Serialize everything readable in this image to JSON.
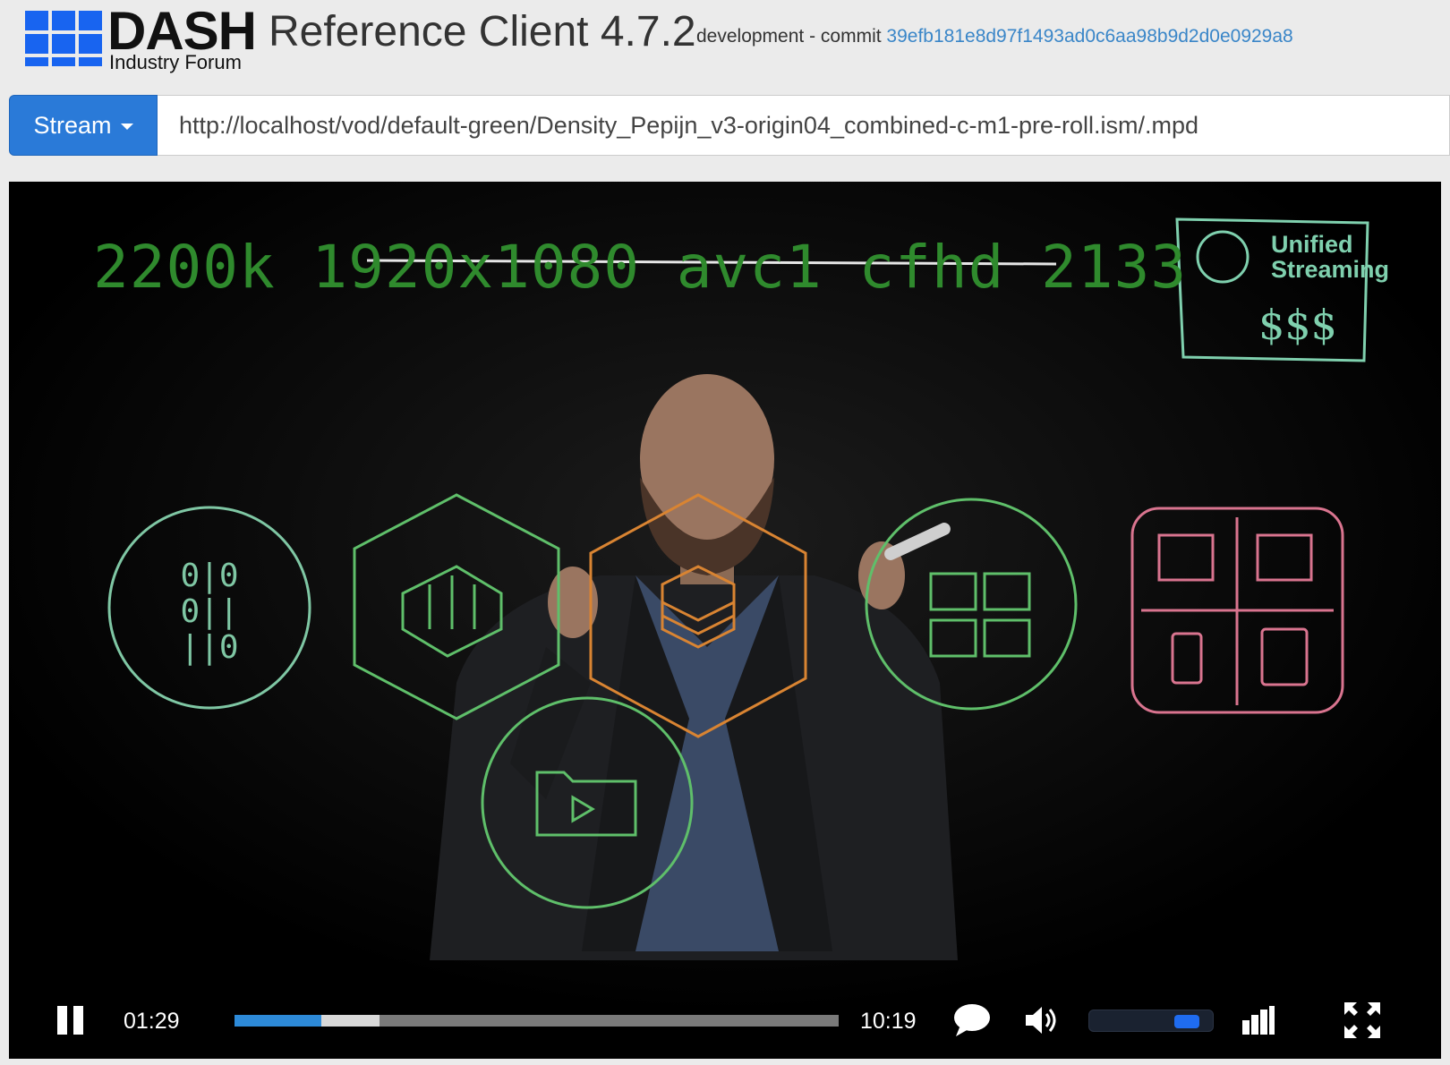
{
  "header": {
    "logo": {
      "main": "DASH",
      "sub": "Industry Forum"
    },
    "title": "Reference Client 4.7.2",
    "subtitle_prefix": "development - commit",
    "commit_hash": "39efb181e8d97f1493ad0c6aa98b9d2d0e0929a8"
  },
  "stream": {
    "button_label": "Stream",
    "url": "http://localhost/vod/default-green/Density_Pepijn_v3-origin04_combined-c-m1-pre-roll.ism/.mpd"
  },
  "video": {
    "overlay_text": "2200k  1920x1080 avc1 cfhd 2133",
    "watermark": {
      "line1": "Unified",
      "line2": "Streaming",
      "scribble": "$$$"
    },
    "background": "#000000"
  },
  "controls": {
    "current_time": "01:29",
    "duration": "10:19",
    "played_fraction": 0.144,
    "buffered_fraction": 0.24,
    "volume_fraction": 0.88,
    "icons": [
      "pause-icon",
      "captions-icon",
      "volume-icon",
      "bitrate-icon",
      "fullscreen-icon"
    ],
    "accent_color": "#2d8ad8"
  }
}
